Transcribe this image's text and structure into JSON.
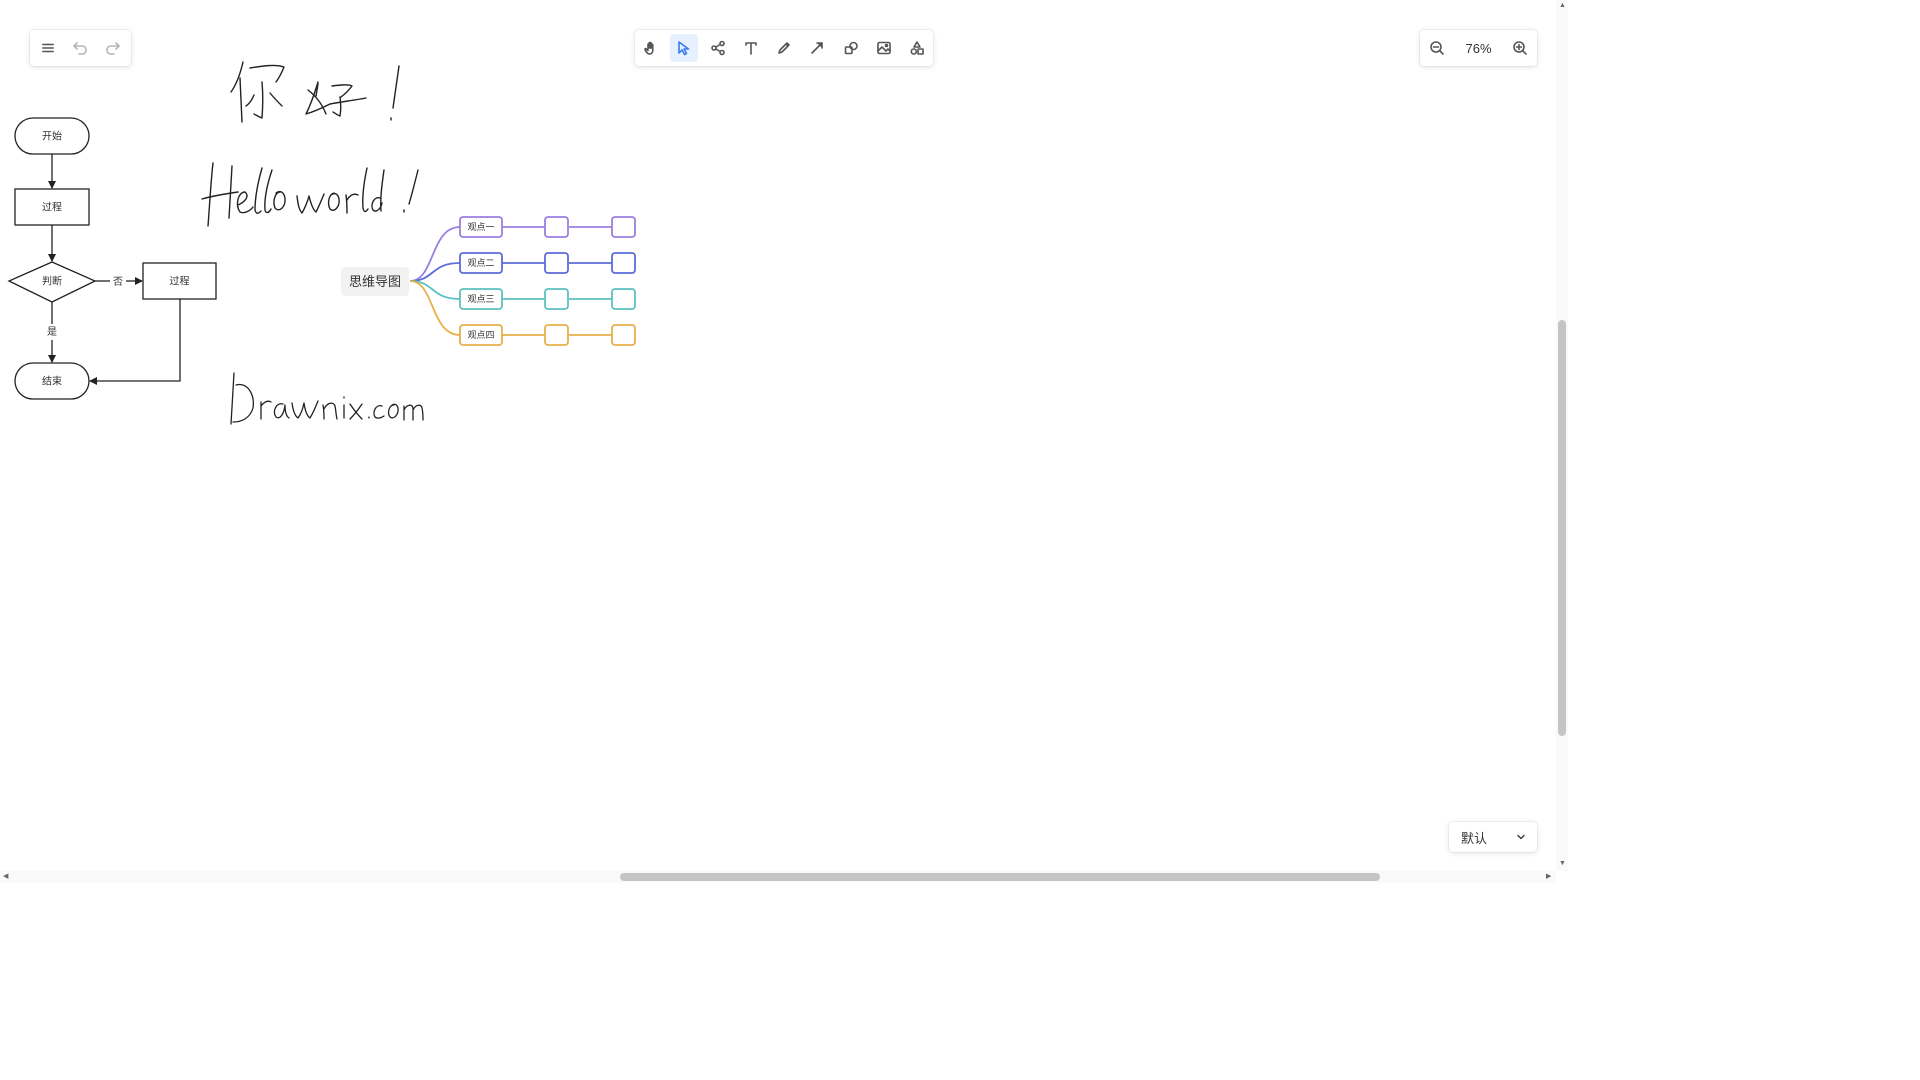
{
  "app_menu": {
    "menu_icon": "hamburger-icon",
    "undo_icon": "undo-icon",
    "redo_icon": "redo-icon"
  },
  "toolbar": {
    "tools": [
      {
        "name": "hand-tool",
        "icon": "hand-icon",
        "active": false
      },
      {
        "name": "select-tool",
        "icon": "pointer-icon",
        "active": true
      },
      {
        "name": "mindmap-tool",
        "icon": "mindmap-icon",
        "active": false
      },
      {
        "name": "text-tool",
        "icon": "text-icon",
        "active": false
      },
      {
        "name": "pen-tool",
        "icon": "pencil-icon",
        "active": false
      },
      {
        "name": "arrow-tool",
        "icon": "arrow-icon",
        "active": false
      },
      {
        "name": "shape-tool",
        "icon": "shapes-icon",
        "active": false
      },
      {
        "name": "image-tool",
        "icon": "image-icon",
        "active": false
      },
      {
        "name": "extra-tool",
        "icon": "extra-shapes-icon",
        "active": false
      }
    ],
    "accent": "#3b7cf0"
  },
  "zoom": {
    "value": "76%",
    "zoom_out_icon": "zoom-out-icon",
    "zoom_in_icon": "zoom-in-icon"
  },
  "flowchart": {
    "start": "开始",
    "process1": "过程",
    "decision": "判断",
    "no_label": "否",
    "yes_label": "是",
    "process2": "过程",
    "end": "结束"
  },
  "handwriting": {
    "line1": "你好！",
    "line2": "Hello world !",
    "line3": "Drawnix.com"
  },
  "mindmap": {
    "root": "思维导图",
    "branches": [
      {
        "label": "观点一",
        "color": "#9b7fe0"
      },
      {
        "label": "观点二",
        "color": "#5b6bd8"
      },
      {
        "label": "观点三",
        "color": "#5cc1c0"
      },
      {
        "label": "观点四",
        "color": "#e8b04a"
      }
    ]
  },
  "theme": {
    "selected": "默认",
    "chevron_icon": "chevron-down-icon"
  }
}
